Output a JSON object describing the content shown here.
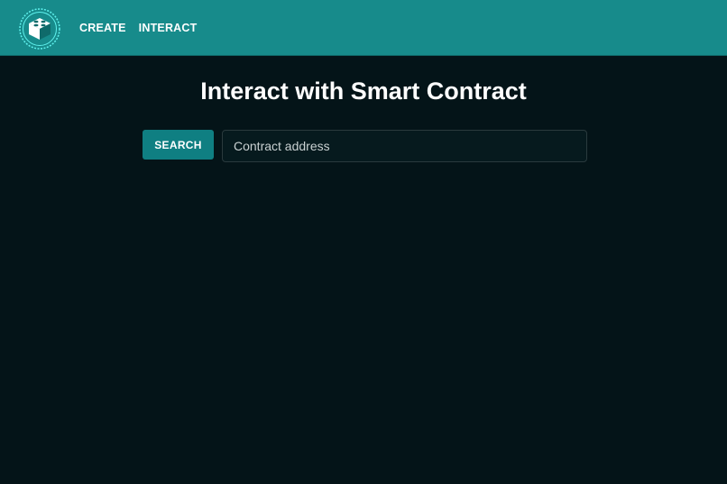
{
  "nav": {
    "logo_icon": "lego-brick-icon",
    "items": [
      {
        "label": "CREATE"
      },
      {
        "label": "INTERACT"
      }
    ]
  },
  "main": {
    "title": "Interact with Smart Contract",
    "search_label": "SEARCH",
    "address_value": "",
    "address_placeholder": "Contract address"
  },
  "colors": {
    "header": "#178b8b",
    "background": "#041418",
    "button": "#0f7f82"
  }
}
